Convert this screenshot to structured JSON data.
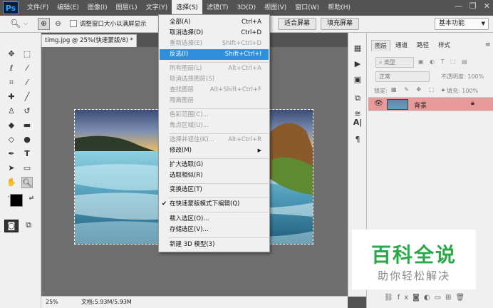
{
  "app": {
    "logo": "Ps"
  },
  "menubar": {
    "items": [
      "文件(F)",
      "编辑(E)",
      "图像(I)",
      "图层(L)",
      "文字(Y)",
      "选择(S)",
      "滤镜(T)",
      "3D(D)",
      "视图(V)",
      "窗口(W)",
      "帮助(H)"
    ],
    "active": "选择(S)"
  },
  "options_bar": {
    "resize_windows_label": "调整窗口大小以满屏显示",
    "fit_screen_label": "适合屏幕",
    "fill_screen_label": "填充屏幕",
    "workspace": "基本功能"
  },
  "document": {
    "tab_title": "timg.jpg @ 25%(快速蒙版/8) *",
    "zoom": "25%",
    "doc_info": "文档:5.93M/5.93M"
  },
  "select_menu": {
    "items": [
      {
        "label": "全部(A)",
        "shortcut": "Ctrl+A",
        "disabled": false
      },
      {
        "label": "取消选择(D)",
        "shortcut": "Ctrl+D",
        "disabled": false
      },
      {
        "label": "重新选择(E)",
        "shortcut": "Shift+Ctrl+D",
        "disabled": true
      },
      {
        "label": "反选(I)",
        "shortcut": "Shift+Ctrl+I",
        "disabled": false,
        "highlighted": true
      },
      {
        "label": "所有图层(L)",
        "shortcut": "Alt+Ctrl+A",
        "disabled": true
      },
      {
        "label": "取消选择图层(S)",
        "shortcut": "",
        "disabled": true
      },
      {
        "label": "查找图层",
        "shortcut": "Alt+Shift+Ctrl+F",
        "disabled": true
      },
      {
        "label": "隔离图层",
        "shortcut": "",
        "disabled": true
      },
      {
        "label": "色彩范围(C)...",
        "shortcut": "",
        "disabled": true
      },
      {
        "label": "焦点区域(U)...",
        "shortcut": "",
        "disabled": true
      },
      {
        "label": "选择并遮住(K)...",
        "shortcut": "Alt+Ctrl+R",
        "disabled": true
      },
      {
        "label": "修改(M)",
        "shortcut": "",
        "disabled": false,
        "submenu": true
      },
      {
        "label": "扩大选取(G)",
        "shortcut": "",
        "disabled": false
      },
      {
        "label": "选取相似(R)",
        "shortcut": "",
        "disabled": false
      },
      {
        "label": "变换选区(T)",
        "shortcut": "",
        "disabled": false
      },
      {
        "label": "在快速蒙版模式下编辑(Q)",
        "shortcut": "",
        "disabled": false,
        "checked": true
      },
      {
        "label": "载入选区(O)...",
        "shortcut": "",
        "disabled": false
      },
      {
        "label": "存储选区(V)...",
        "shortcut": "",
        "disabled": false
      },
      {
        "label": "新建 3D 模型(3)",
        "shortcut": "",
        "disabled": false
      }
    ]
  },
  "layers_panel": {
    "tabs": [
      "图层",
      "通道",
      "路径",
      "样式"
    ],
    "filter_label": "类型",
    "blend_mode": "正常",
    "opacity_label": "不透明度: 100%",
    "lock_label": "锁定:",
    "fill_label": "填充: 100%",
    "layer_name": "背景"
  },
  "watermark": {
    "title": "百科全说",
    "subtitle": "助你轻松解决"
  },
  "colors": {
    "highlight": "#2f8fdc",
    "layer_selected": "#e8999a",
    "watermark_title": "#2aa84a"
  }
}
